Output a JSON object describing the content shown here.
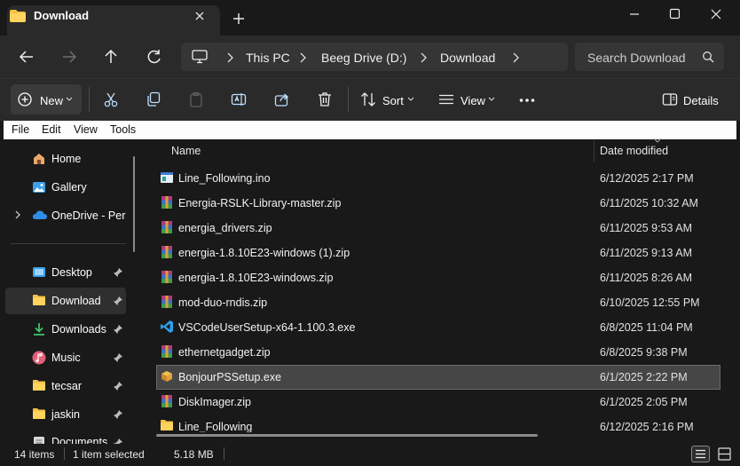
{
  "window": {
    "tab_title": "Download"
  },
  "breadcrumb": {
    "items": [
      "This PC",
      "Beeg Drive (D:)",
      "Download"
    ]
  },
  "search": {
    "placeholder": "Search Download"
  },
  "toolbar": {
    "new_label": "New",
    "sort_label": "Sort",
    "view_label": "View",
    "details_label": "Details"
  },
  "menu": {
    "items": [
      "File",
      "Edit",
      "View",
      "Tools"
    ]
  },
  "nav": {
    "items": [
      {
        "label": "Home",
        "icon": "home-icon"
      },
      {
        "label": "Gallery",
        "icon": "gallery-icon"
      },
      {
        "label": "OneDrive - Perso",
        "icon": "onedrive-icon"
      },
      {
        "label": "Desktop",
        "icon": "desktop-icon",
        "pinned": true
      },
      {
        "label": "Download",
        "icon": "folder-icon",
        "pinned": true,
        "selected": true
      },
      {
        "label": "Downloads",
        "icon": "downloads-icon",
        "pinned": true
      },
      {
        "label": "Music",
        "icon": "music-icon",
        "pinned": true
      },
      {
        "label": "tecsar",
        "icon": "folder-icon",
        "pinned": true
      },
      {
        "label": "jaskin",
        "icon": "folder-icon",
        "pinned": true
      },
      {
        "label": "Documents",
        "icon": "documents-icon",
        "pinned": true
      }
    ]
  },
  "file_list": {
    "columns": [
      "Name",
      "Date modified"
    ],
    "rows": [
      {
        "name": "Line_Following.ino",
        "date": "6/12/2025 2:17 PM",
        "icon": "ino-file-icon"
      },
      {
        "name": "Energia-RSLK-Library-master.zip",
        "date": "6/11/2025 10:32 AM",
        "icon": "zip-archive-icon"
      },
      {
        "name": "energia_drivers.zip",
        "date": "6/11/2025 9:53 AM",
        "icon": "zip-archive-icon"
      },
      {
        "name": "energia-1.8.10E23-windows (1).zip",
        "date": "6/11/2025 9:13 AM",
        "icon": "zip-archive-icon"
      },
      {
        "name": "energia-1.8.10E23-windows.zip",
        "date": "6/11/2025 8:26 AM",
        "icon": "zip-archive-icon"
      },
      {
        "name": "mod-duo-rndis.zip",
        "date": "6/10/2025 12:55 PM",
        "icon": "zip-archive-icon"
      },
      {
        "name": "VSCodeUserSetup-x64-1.100.3.exe",
        "date": "6/8/2025 11:04 PM",
        "icon": "vscode-icon"
      },
      {
        "name": "ethernetgadget.zip",
        "date": "6/8/2025 9:38 PM",
        "icon": "zip-archive-icon"
      },
      {
        "name": "BonjourPSSetup.exe",
        "date": "6/1/2025 2:22 PM",
        "icon": "installer-icon",
        "selected": true
      },
      {
        "name": "DiskImager.zip",
        "date": "6/1/2025 2:05 PM",
        "icon": "zip-archive-icon"
      },
      {
        "name": "Line_Following",
        "date": "6/12/2025 2:16 PM",
        "icon": "folder-icon"
      }
    ]
  },
  "status": {
    "item_count": "14 items",
    "selection": "1 item selected",
    "size": "5.18 MB"
  },
  "colors": {
    "accent": "#0078d4",
    "folder": "#f4c247",
    "background": "#191919"
  }
}
